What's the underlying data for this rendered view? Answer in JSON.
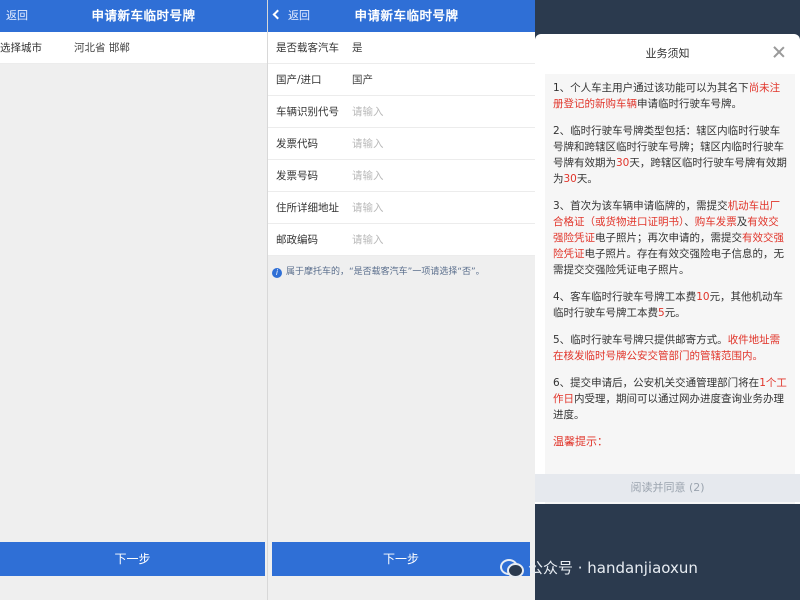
{
  "panel1": {
    "back_label": "返回",
    "title": "申请新车临时号牌",
    "row": {
      "label": "选择城市",
      "value": "河北省 邯郸"
    },
    "next_button": "下一步"
  },
  "panel2": {
    "back_label": "返回",
    "title": "申请新车临时号牌",
    "rows": [
      {
        "label": "是否载客汽车",
        "value": "是"
      },
      {
        "label": "国产/进口",
        "value": "国产"
      },
      {
        "label": "车辆识别代号",
        "placeholder": "请输入"
      },
      {
        "label": "发票代码",
        "placeholder": "请输入"
      },
      {
        "label": "发票号码",
        "placeholder": "请输入"
      },
      {
        "label": "住所详细地址",
        "placeholder": "请输入"
      },
      {
        "label": "邮政编码",
        "placeholder": "请输入"
      }
    ],
    "tip": "属于摩托车的，“是否载客汽车”一项请选择“否”。",
    "next_button": "下一步"
  },
  "modal": {
    "title": "业务须知",
    "items": [
      {
        "parts": [
          {
            "t": "1、个人车主用户通过该功能可以为其名下"
          },
          {
            "t": "尚未注册登记的新购车辆",
            "red": true
          },
          {
            "t": "申请临时行驶车号牌。"
          }
        ]
      },
      {
        "parts": [
          {
            "t": "2、临时行驶车号牌类型包括：辖区内临时行驶车号牌和跨辖区临时行驶车号牌；辖区内临时行驶车号牌有效期为"
          },
          {
            "t": "30",
            "red": true
          },
          {
            "t": "天，跨辖区临时行驶车号牌有效期为"
          },
          {
            "t": "30",
            "red": true
          },
          {
            "t": "天。"
          }
        ]
      },
      {
        "parts": [
          {
            "t": "3、首次为该车辆申请临牌的，需提交"
          },
          {
            "t": "机动车出厂合格证（或货物进口证明书）",
            "red": true
          },
          {
            "t": "、"
          },
          {
            "t": "购车发票",
            "red": true
          },
          {
            "t": "及"
          },
          {
            "t": "有效交强险凭证",
            "red": true
          },
          {
            "t": "电子照片；再次申请的，需提交"
          },
          {
            "t": "有效交强险凭证",
            "red": true
          },
          {
            "t": "电子照片。存在有效交强险电子信息的，无需提交交强险凭证电子照片。"
          }
        ]
      },
      {
        "parts": [
          {
            "t": "4、客车临时行驶车号牌工本费"
          },
          {
            "t": "10",
            "red": true
          },
          {
            "t": "元，其他机动车临时行驶车号牌工本费"
          },
          {
            "t": "5",
            "red": true
          },
          {
            "t": "元。"
          }
        ]
      },
      {
        "parts": [
          {
            "t": "5、临时行驶车号牌只提供邮寄方式。"
          },
          {
            "t": "收件地址需在核发临时号牌公安交管部门的管辖范围内。",
            "red": true
          }
        ]
      },
      {
        "parts": [
          {
            "t": "6、提交申请后，公安机关交通管理部门将在"
          },
          {
            "t": "1个工作日",
            "red": true
          },
          {
            "t": "内受理，期间可以通过网办进度查询业务办理进度。"
          }
        ]
      }
    ],
    "warm_tip": "温馨提示：",
    "footer_button": "阅读并同意 (2)"
  },
  "watermark": "公众号 · handanjiaoxun"
}
